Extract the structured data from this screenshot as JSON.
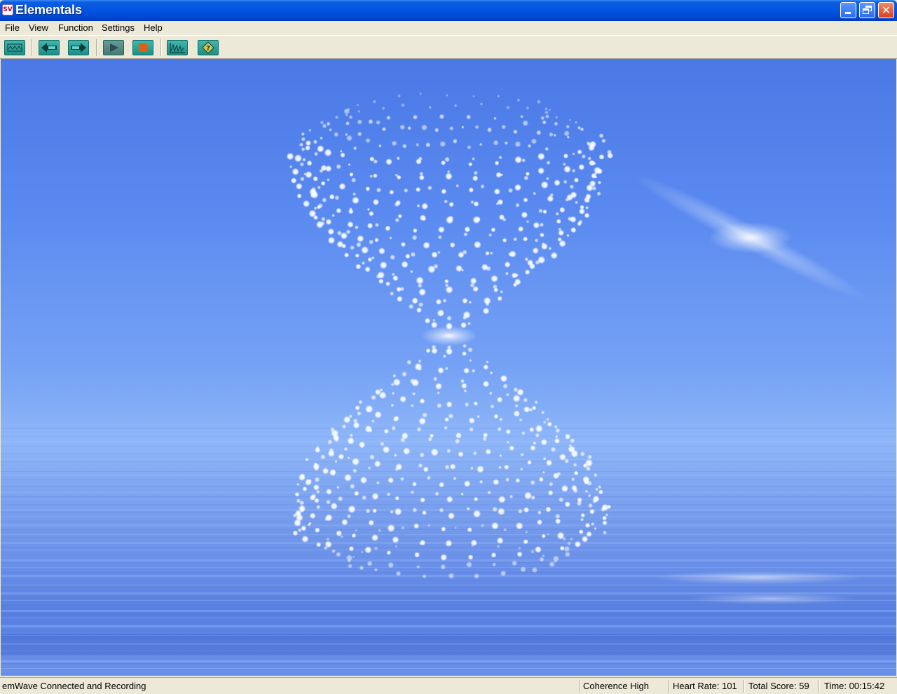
{
  "window": {
    "icon_text": "SV",
    "title": "Elementals",
    "minimize_icon": "minimize-icon",
    "restore_icon": "restore-icon",
    "close_icon": "close-icon"
  },
  "menu": {
    "items": [
      "File",
      "View",
      "Function",
      "Settings",
      "Help"
    ]
  },
  "toolbar": {
    "buttons": [
      {
        "icon": "coherence-screen-icon"
      },
      {
        "icon": "previous-arrow-icon"
      },
      {
        "icon": "next-arrow-icon"
      },
      {
        "icon": "play-icon"
      },
      {
        "icon": "stop-icon"
      },
      {
        "icon": "heart-rhythm-chart-icon"
      },
      {
        "icon": "help-question-icon"
      }
    ],
    "accent": "#2aa39c",
    "stop_color": "#e06010"
  },
  "status": {
    "connection": "emWave Connected and Recording",
    "coherence": "Coherence High",
    "heart_rate": "Heart Rate: 101",
    "total_score": "Total Score: 59",
    "time": "Time: 00:15:42"
  }
}
